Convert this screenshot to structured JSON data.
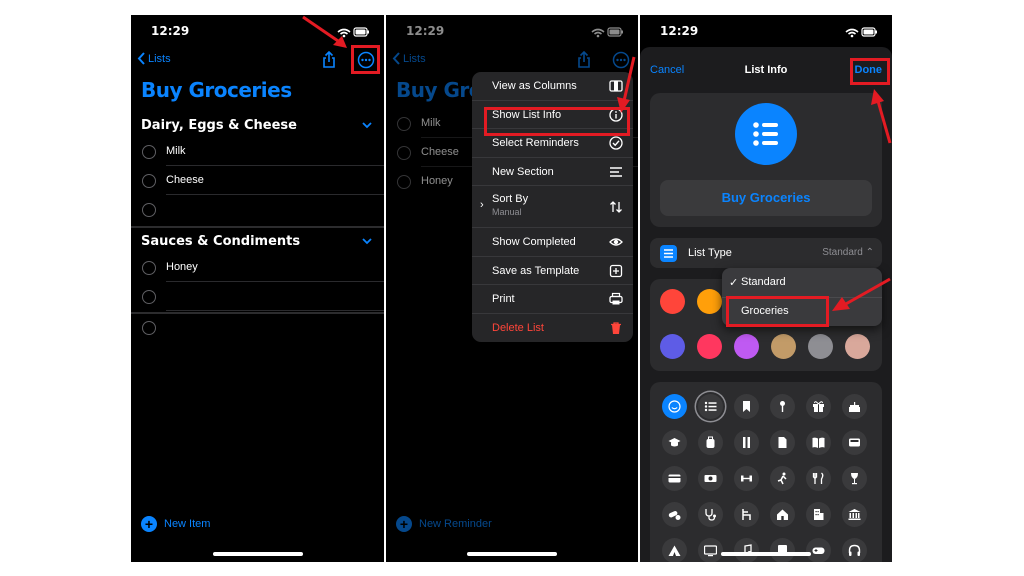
{
  "status": {
    "time": "12:29"
  },
  "screen1": {
    "back_label": "Lists",
    "title": "Buy Groceries",
    "sections": [
      {
        "title": "Dairy, Eggs & Cheese",
        "items": [
          "Milk",
          "Cheese",
          ""
        ]
      },
      {
        "title": "Sauces & Condiments",
        "items": [
          "Honey",
          "",
          ""
        ]
      }
    ],
    "new_item_label": "New Item"
  },
  "screen2": {
    "back_label": "Lists",
    "title": "Buy Groceries",
    "items": [
      "Milk",
      "Cheese",
      "Honey"
    ],
    "new_reminder_label": "New Reminder",
    "menu": [
      {
        "label": "View as Columns",
        "icon": "columns-icon"
      },
      {
        "label": "Show List Info",
        "icon": "info-icon",
        "highlighted": true
      },
      {
        "label": "Select Reminders",
        "icon": "checkmark-circle-icon"
      },
      {
        "label": "New Section",
        "icon": "section-lines-icon"
      },
      {
        "label": "Sort By",
        "sublabel": "Manual",
        "icon": "sort-arrows-icon"
      },
      {
        "label": "Show Completed",
        "icon": "eye-icon"
      },
      {
        "label": "Save as Template",
        "icon": "template-icon"
      },
      {
        "label": "Print",
        "icon": "printer-icon"
      },
      {
        "label": "Delete List",
        "icon": "trash-icon",
        "destructive": true
      }
    ]
  },
  "screen3": {
    "cancel_label": "Cancel",
    "title": "List Info",
    "done_label": "Done",
    "list_name": "Buy Groceries",
    "list_type_label": "List Type",
    "list_type_value": "Standard",
    "dropdown": {
      "options": [
        "Standard",
        "Groceries"
      ],
      "checked": "Standard",
      "check_mark": "✓"
    },
    "colors": [
      "#ff453a",
      "#ff9f0a",
      "#ffd60a",
      "#30d158",
      "#64d2ff",
      "#0a84ff",
      "#5e5ce6",
      "#ff375f",
      "#bf5af2",
      "#c29b68",
      "#8e8e93",
      "#d9a89b"
    ]
  },
  "colors": {
    "accent": "#0a84ff",
    "annotation": "#e31b23",
    "destructive": "#ff453a",
    "background": "#000000"
  }
}
